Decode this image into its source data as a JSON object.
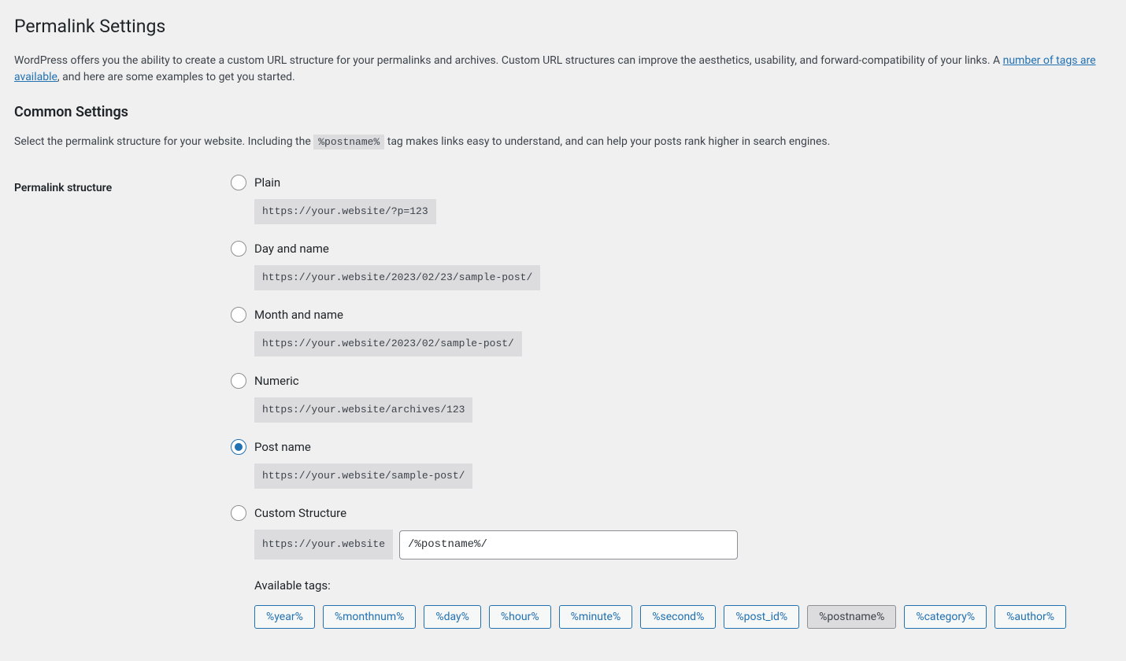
{
  "header": {
    "title": "Permalink Settings",
    "description_pre": "WordPress offers you the ability to create a custom URL structure for your permalinks and archives. Custom URL structures can improve the aesthetics, usability, and forward-compatibility of your links. A ",
    "description_link": "number of tags are available",
    "description_post": ", and here are some examples to get you started."
  },
  "common_settings": {
    "heading": "Common Settings",
    "description_pre": "Select the permalink structure for your website. Including the ",
    "description_code": "%postname%",
    "description_post": " tag makes links easy to understand, and can help your posts rank higher in search engines."
  },
  "permalink": {
    "label": "Permalink structure",
    "options": {
      "plain": {
        "label": "Plain",
        "example": "https://your.website/?p=123"
      },
      "day_name": {
        "label": "Day and name",
        "example": "https://your.website/2023/02/23/sample-post/"
      },
      "month_name": {
        "label": "Month and name",
        "example": "https://your.website/2023/02/sample-post/"
      },
      "numeric": {
        "label": "Numeric",
        "example": "https://your.website/archives/123"
      },
      "post_name": {
        "label": "Post name",
        "example": "https://your.website/sample-post/"
      },
      "custom": {
        "label": "Custom Structure",
        "prefix": "https://your.website",
        "value": "/%postname%/"
      }
    },
    "selected": "post_name",
    "available_tags_label": "Available tags:",
    "tags": [
      {
        "text": "%year%",
        "active": false
      },
      {
        "text": "%monthnum%",
        "active": false
      },
      {
        "text": "%day%",
        "active": false
      },
      {
        "text": "%hour%",
        "active": false
      },
      {
        "text": "%minute%",
        "active": false
      },
      {
        "text": "%second%",
        "active": false
      },
      {
        "text": "%post_id%",
        "active": false
      },
      {
        "text": "%postname%",
        "active": true
      },
      {
        "text": "%category%",
        "active": false
      },
      {
        "text": "%author%",
        "active": false
      }
    ]
  }
}
